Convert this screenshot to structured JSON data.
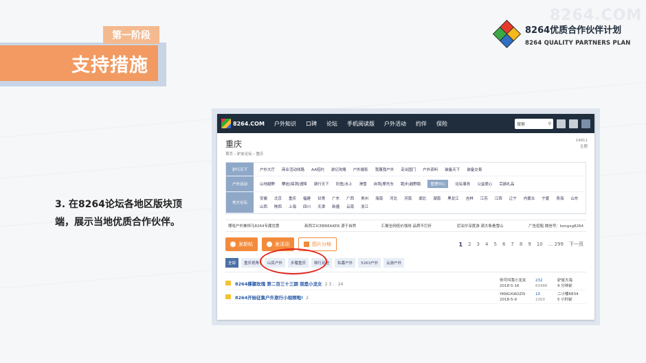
{
  "slide": {
    "stage": "第一阶段",
    "title": "支持措施",
    "brand_title": "8264优质合作伙伴计划",
    "brand_sub": "8264 QUALITY PARTNERS PLAN",
    "watermark": "8264.COM",
    "description": "3.  在8264论坛各地区版块顶端，展示当地优质合作伙伴。"
  },
  "forum": {
    "logo": "8264.COM",
    "nav": [
      "户外知识",
      "口碑",
      "论坛",
      "手机阅读版",
      "户外活动",
      "约伴",
      "保险"
    ],
    "search_placeholder": "搜索",
    "city": "重庆",
    "breadcrumb": "首页 › 驴友论坛 › 重庆",
    "stats": [
      "14911",
      "主题"
    ],
    "categories": [
      {
        "head": "驴行天下",
        "items": [
          "户外大厅",
          "商业活动线路",
          "AA招约",
          "游记攻略",
          "户外摄影",
          "我蔑我户外",
          "走出国门",
          "户外资料",
          "装备天下",
          "装备交易"
        ]
      },
      {
        "head": "户外运动",
        "items": [
          "山地越野",
          "攀岩|探洞|速降",
          "骑行天下",
          "钓鱼|水上",
          "滑雪",
          "自驾|摩托车",
          "跑步|越野跑",
          "管理中心",
          "论坛事务",
          "公益爱心",
          "完赫礼品"
        ]
      },
      {
        "head": "地方论坛",
        "items": [
          "安徽",
          "北京",
          "重庆",
          "福建",
          "甘肃",
          "广东",
          "广西",
          "贵州",
          "海南",
          "河北",
          "河南",
          "湖北",
          "湖南",
          "黑龙江",
          "吉林",
          "江苏",
          "江西",
          "辽宁",
          "内蒙古",
          "宁夏",
          "青海",
          "山东",
          "山西",
          "陕西",
          "上海",
          "四川",
          "天津",
          "新疆",
          "云南",
          "浙江"
        ]
      }
    ],
    "active_category": "管理中心",
    "notices": [
      "哪哈户外推恒马8264专属优惠",
      "新西兰ICEBREAKER 源于自然",
      "汇聚全网低价强线 品质不打折",
      "尼泊尔深度游 骑大象看雪山",
      "广告招租 微信号：kongxg8264"
    ],
    "buttons": {
      "post": "发新帖",
      "activity": "发活动",
      "image_view": "图片分格"
    },
    "pager": [
      "1",
      "2",
      "3",
      "4",
      "5",
      "6",
      "7",
      "8",
      "9",
      "10",
      "... 299",
      "下一页"
    ],
    "filters": [
      "全部",
      "重庆视角",
      "山民户外",
      "步履重庆",
      "释行足迹",
      "私募户外",
      "5263户外",
      "云游户外"
    ],
    "threads": [
      {
        "title": "8264撑骡玫瑰 第二百三十三期 我是小龙女",
        "pages": "2 3 . . 24",
        "author": [
          "你可叫我小龙女",
          "2018-5-16"
        ],
        "count": [
          "232",
          "60486"
        ],
        "last": [
          "驴鼠大海",
          "9 分钟前"
        ]
      },
      {
        "title": "8264开始征集户外旅行小视频啦!",
        "pages": "2",
        "author": [
          "YANGXIAOZIS",
          "2018-5-9"
        ],
        "count": [
          "10",
          "1000"
        ],
        "last": [
          "二小楼6834",
          "5 小时前"
        ]
      }
    ]
  }
}
